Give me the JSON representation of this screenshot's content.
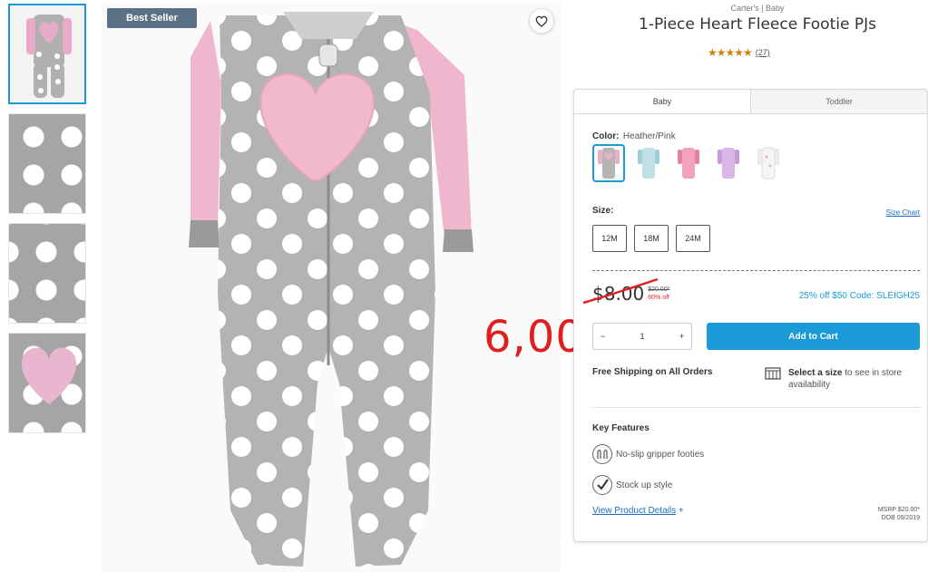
{
  "badge": "Best Seller",
  "overlay_price": "6,00",
  "product": {
    "brand": "Carter's | Baby",
    "title": "1-Piece Heart Fleece Footie PJs",
    "stars": "★★★★★",
    "review_count": "(27)"
  },
  "tabs": [
    "Baby",
    "Toddler"
  ],
  "color": {
    "label": "Color:",
    "value": "Heather/Pink",
    "swatches": [
      "gray-pink",
      "light-blue",
      "pink",
      "lavender",
      "white-print"
    ]
  },
  "size": {
    "label": "Size:",
    "chart_link": "Size Chart",
    "options": [
      "12M",
      "18M",
      "24M"
    ]
  },
  "price": {
    "sale": "$8.00",
    "original": "$20.00*",
    "discount": "60% off",
    "promo": "25% off $50 Code: SLEIGH25"
  },
  "quantity": {
    "minus": "−",
    "value": "1",
    "plus": "+"
  },
  "cart_button": "Add to Cart",
  "shipping": "Free Shipping on All Orders",
  "store": {
    "bold": "Select a size",
    "rest": " to see in store availability"
  },
  "key_features": {
    "title": "Key Features",
    "items": [
      "No-slip gripper footies",
      "Stock up style"
    ]
  },
  "details_link": "View Product Details",
  "details_plus": "+",
  "msrp": "MSRP $20.00*",
  "dob": "DOB 09/2019",
  "colors": {
    "accent": "#1a9ad6",
    "badge": "#5b7286",
    "overlay": "#e21f1f"
  }
}
